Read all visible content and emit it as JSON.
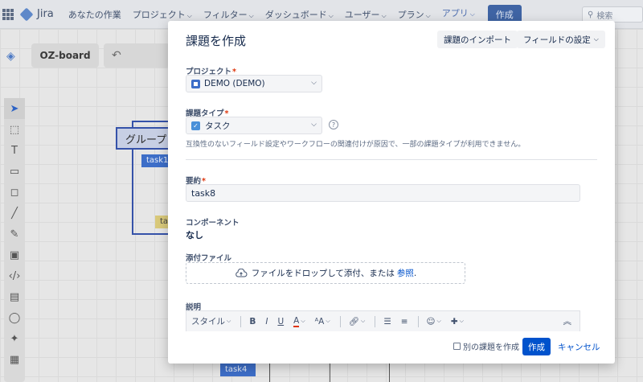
{
  "nav": {
    "logo_text": "Jira",
    "items": [
      {
        "label": "あなたの作業",
        "has_chevron": false
      },
      {
        "label": "プロジェクト",
        "has_chevron": true
      },
      {
        "label": "フィルター",
        "has_chevron": true
      },
      {
        "label": "ダッシュボード",
        "has_chevron": true
      },
      {
        "label": "ユーザー",
        "has_chevron": true
      },
      {
        "label": "プラン",
        "has_chevron": true
      },
      {
        "label": "アプリ",
        "has_chevron": true,
        "active": true
      }
    ],
    "create_label": "作成",
    "search_placeholder": "検索"
  },
  "board": {
    "name": "OZ-board",
    "group_title": "グループ",
    "card_blue": "task1",
    "card_yellow": "task",
    "card_bottom": "task4"
  },
  "modal": {
    "title": "課題を作成",
    "import_label": "課題のインポート",
    "field_settings_label": "フィールドの設定",
    "project": {
      "label": "プロジェクト",
      "value": "DEMO (DEMO)"
    },
    "issue_type": {
      "label": "課題タイプ",
      "value": "タスク"
    },
    "issue_type_note": "互換性のないフィールド設定やワークフローの関連付けが原因で、一部の課題タイプが利用できません。",
    "summary": {
      "label": "要約",
      "value": "task8"
    },
    "component": {
      "label": "コンポーネント",
      "value": "なし"
    },
    "attachment": {
      "label": "添付ファイル",
      "drop_text": "ファイルをドロップして添付、または",
      "browse_link": "参照",
      "suffix": "."
    },
    "description": {
      "label": "説明",
      "style_label": "スタイル"
    },
    "footer": {
      "another_label": "別の課題を作成",
      "create_label": "作成",
      "cancel_label": "キャンセル"
    }
  },
  "colors": {
    "primary": "#0052cc",
    "required": "#de350b",
    "top_create": "#3f64a4"
  }
}
